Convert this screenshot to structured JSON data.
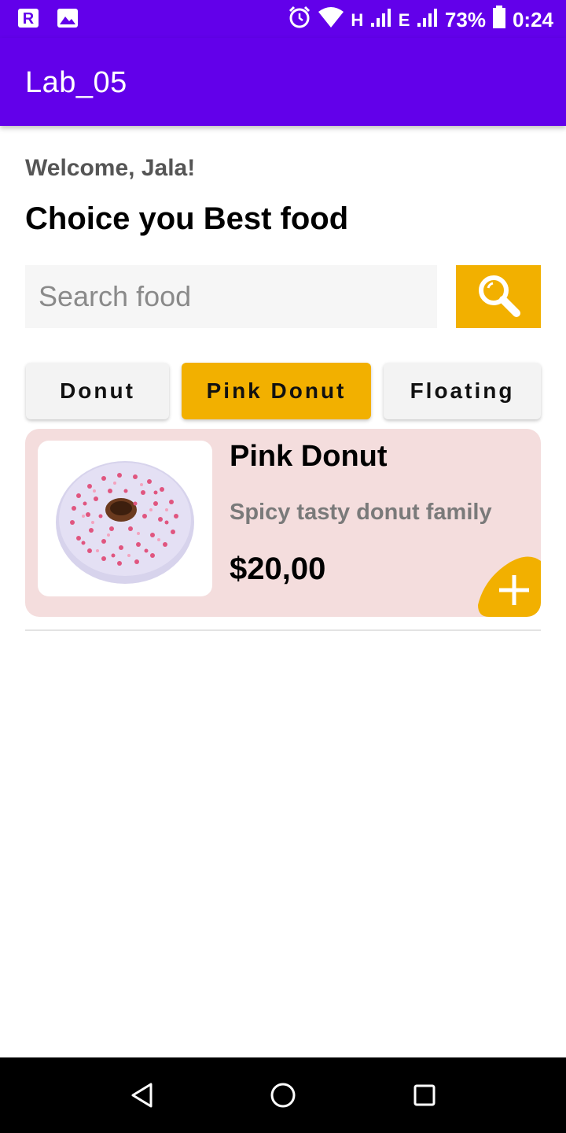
{
  "status_bar": {
    "network": "H",
    "network2": "E",
    "battery": "73%",
    "time": "0:24"
  },
  "app_bar": {
    "title": "Lab_05"
  },
  "welcome_text": "Welcome, Jala!",
  "headline": "Choice you Best food",
  "search": {
    "placeholder": "Search food",
    "value": ""
  },
  "categories": [
    {
      "label": "Donut",
      "selected": false
    },
    {
      "label": "Pink Donut",
      "selected": true
    },
    {
      "label": "Floating",
      "selected": false
    }
  ],
  "product": {
    "name": "Pink Donut",
    "description": "Spicy tasty donut family",
    "price": "$20,00",
    "image": "pink-sprinkled-donut"
  },
  "colors": {
    "primary": "#6200ea",
    "accent": "#f2b000",
    "card_background": "#f4dddd"
  },
  "icons": {
    "search": "search-icon",
    "add": "plus-icon",
    "back": "back-triangle-icon",
    "home": "home-circle-icon",
    "recents": "recents-square-icon"
  }
}
